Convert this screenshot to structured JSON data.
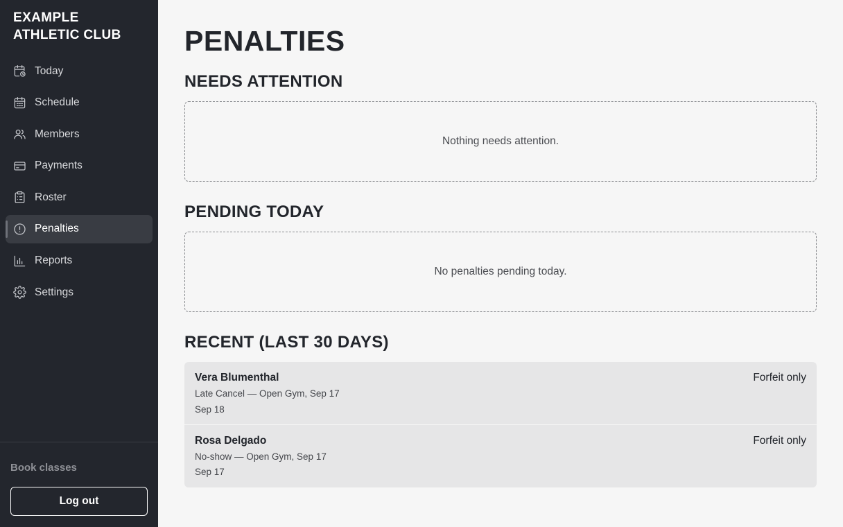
{
  "sidebar": {
    "brand": "EXAMPLE ATHLETIC CLUB",
    "items": [
      {
        "label": "Today",
        "icon": "calendar-clock-icon"
      },
      {
        "label": "Schedule",
        "icon": "calendar-icon"
      },
      {
        "label": "Members",
        "icon": "users-icon"
      },
      {
        "label": "Payments",
        "icon": "credit-card-icon"
      },
      {
        "label": "Roster",
        "icon": "clipboard-list-icon"
      },
      {
        "label": "Penalties",
        "icon": "alert-circle-icon",
        "active": true
      },
      {
        "label": "Reports",
        "icon": "bar-chart-icon"
      },
      {
        "label": "Settings",
        "icon": "gear-icon"
      }
    ],
    "book_classes": "Book classes",
    "logout": "Log out"
  },
  "main": {
    "title": "PENALTIES",
    "needs_attention": {
      "title": "NEEDS ATTENTION",
      "empty": "Nothing needs attention."
    },
    "pending_today": {
      "title": "PENDING TODAY",
      "empty": "No penalties pending today."
    },
    "recent": {
      "title": "RECENT (LAST 30 DAYS)",
      "rows": [
        {
          "name": "Vera Blumenthal",
          "detail": "Late Cancel — Open Gym, Sep 17",
          "date": "Sep 18",
          "outcome": "Forfeit only"
        },
        {
          "name": "Rosa Delgado",
          "detail": "No-show — Open Gym, Sep 17",
          "date": "Sep 17",
          "outcome": "Forfeit only"
        }
      ]
    }
  },
  "colors": {
    "sidebar_bg": "#23262d",
    "active_item_bg": "#393c43",
    "page_bg": "#f6f6f6",
    "row_bg": "#e6e6e7"
  }
}
